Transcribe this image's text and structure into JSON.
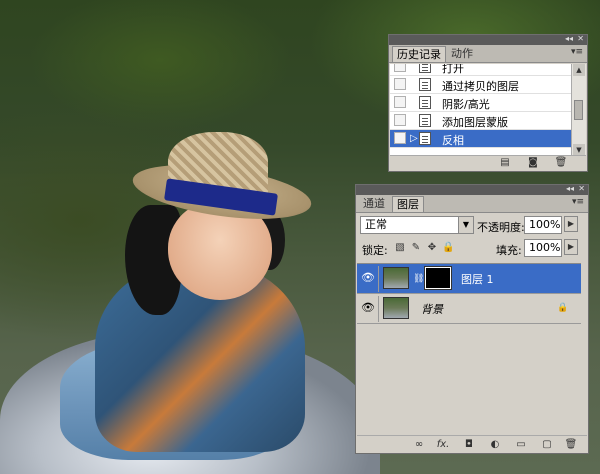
{
  "history_panel": {
    "tabs": [
      {
        "label": "历史记录",
        "active": true
      },
      {
        "label": "动作",
        "active": false
      }
    ],
    "items": [
      {
        "label": "打开",
        "selected": false
      },
      {
        "label": "通过拷贝的图层",
        "selected": false
      },
      {
        "label": "阴影/高光",
        "selected": false
      },
      {
        "label": "添加图层蒙版",
        "selected": false
      },
      {
        "label": "反相",
        "selected": true
      }
    ],
    "footer_icons": [
      "new-document-from-state-icon",
      "snapshot-camera-icon",
      "trash-icon"
    ]
  },
  "layers_panel": {
    "tabs": [
      {
        "label": "通道",
        "active": false
      },
      {
        "label": "图层",
        "active": true
      }
    ],
    "blend_mode": "正常",
    "opacity_label": "不透明度:",
    "opacity_value": "100%",
    "lock_label": "锁定:",
    "fill_label": "填充:",
    "fill_value": "100%",
    "lock_icons": [
      "lock-transparency-icon",
      "lock-paint-icon",
      "lock-move-icon",
      "lock-all-icon"
    ],
    "layers": [
      {
        "name": "图层 1",
        "selected": true,
        "has_mask": true,
        "italic": false
      },
      {
        "name": "背景",
        "selected": false,
        "has_mask": false,
        "italic": true,
        "locked": true
      }
    ],
    "footer_icons": [
      "link-layers-icon",
      "fx-icon",
      "add-mask-icon",
      "adjustment-layer-icon",
      "new-group-icon",
      "new-layer-icon",
      "delete-layer-icon"
    ],
    "footer_glyphs": [
      "∞",
      "fx.",
      "◘",
      "◐",
      "▭",
      "▢",
      "🗑"
    ]
  },
  "colors": {
    "panel_bg": "#d4d0c8",
    "selection": "#3a6cc6",
    "titlebar": "#5a5a5a"
  }
}
